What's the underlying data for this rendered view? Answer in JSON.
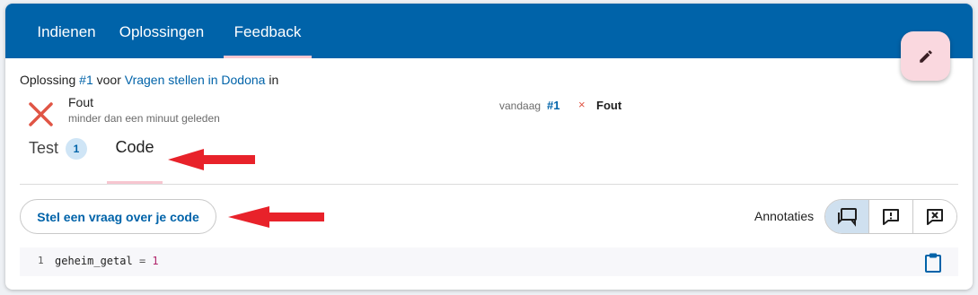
{
  "nav": {
    "tabs": [
      {
        "label": "Indienen"
      },
      {
        "label": "Oplossingen"
      },
      {
        "label": "Feedback"
      }
    ]
  },
  "fab": {
    "icon": "pencil-icon"
  },
  "submission": {
    "prefix": "Oplossing",
    "number_link": "#1",
    "middle": "voor",
    "exercise_link": "Vragen stellen in Dodona",
    "suffix": "in"
  },
  "status": {
    "icon": "cross-icon",
    "title": "Fout",
    "time": "minder dan een minuut geleden"
  },
  "meta": {
    "day": "vandaag",
    "number": "#1",
    "result_icon": "×",
    "result": "Fout"
  },
  "feedback_tabs": [
    {
      "label": "Test",
      "badge": "1"
    },
    {
      "label": "Code"
    }
  ],
  "ask_button": {
    "label": "Stel een vraag over je code"
  },
  "annotations": {
    "label": "Annotaties",
    "buttons": [
      "show-comments-icon",
      "show-feedback-icon",
      "hide-annotations-icon"
    ]
  },
  "code": {
    "line_number": "1",
    "identifier": "geheim_getal",
    "operator": "=",
    "value": "1"
  },
  "colors": {
    "brand": "#0063a9",
    "error": "#e05545",
    "arrow": "#e8222a",
    "tab_indicator": "#f7c6d0"
  }
}
